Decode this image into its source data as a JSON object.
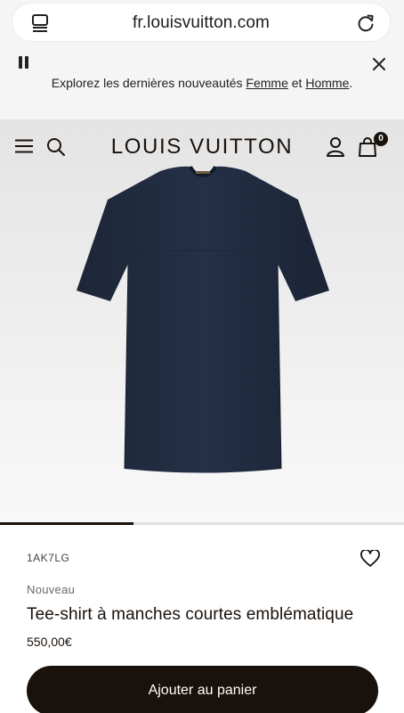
{
  "browser": {
    "url": "fr.louisvuitton.com",
    "tabs_icon": "tabs-icon",
    "reload_icon": "reload-icon"
  },
  "promo": {
    "text_before": "Explorez les dernières nouveautés ",
    "link_women": "Femme",
    "text_middle": " et ",
    "link_men": "Homme",
    "text_after": ".",
    "pause_icon": "pause-icon",
    "close_icon": "close-icon"
  },
  "header": {
    "logo": "LOUIS VUITTON",
    "menu_icon": "hamburger-menu-icon",
    "search_icon": "search-icon",
    "account_icon": "account-icon",
    "bag_icon": "shopping-bag-icon",
    "bag_count": "0"
  },
  "product": {
    "sku": "1AK7LG",
    "status": "Nouveau",
    "title": "Tee-shirt à manches courtes emblématique",
    "price": "550,00€",
    "add_to_cart": "Ajouter au panier",
    "wishlist_icon": "heart-icon",
    "image_progress": 0.33
  },
  "colors": {
    "brand_dark": "#19110b",
    "shirt_navy": "#1f2a3d",
    "background_gray": "#f5f5f5"
  }
}
